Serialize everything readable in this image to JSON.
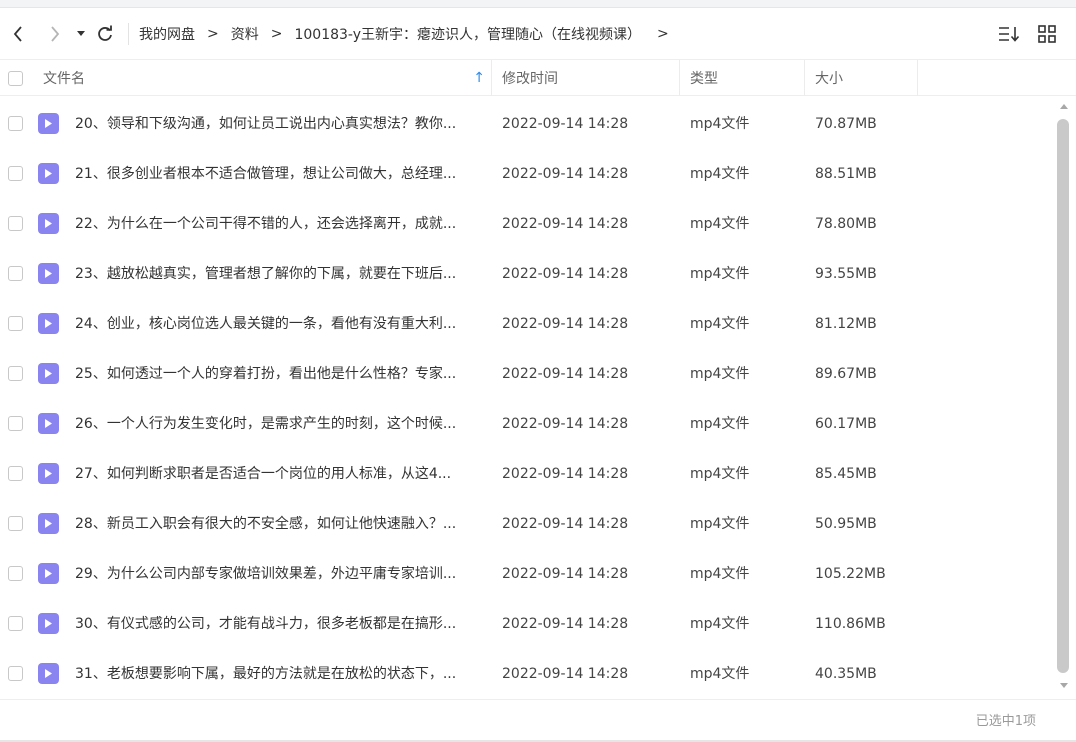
{
  "toolbar": {
    "back_icon": "chevron-left-icon",
    "forward_icon": "chevron-right-icon",
    "dropdown_icon": "caret-down-icon",
    "refresh_icon": "refresh-icon",
    "breadcrumb": [
      "我的网盘",
      "资料",
      "100183-y王新宇：瘪迹识人，管理随心（在线视频课）"
    ],
    "separator": ">",
    "sort_icon": "sort-list-icon",
    "grid_icon": "grid-view-icon"
  },
  "table": {
    "headers": {
      "name": "文件名",
      "modified": "修改时间",
      "type": "类型",
      "size": "大小"
    },
    "sort_indicator": "↑",
    "rows": [
      {
        "name": "20、领导和下级沟通，如何让员工说出内心真实想法？教你...",
        "modified": "2022-09-14 14:28",
        "type": "mp4文件",
        "size": "70.87MB"
      },
      {
        "name": "21、很多创业者根本不适合做管理，想让公司做大，总经理...",
        "modified": "2022-09-14 14:28",
        "type": "mp4文件",
        "size": "88.51MB"
      },
      {
        "name": "22、为什么在一个公司干得不错的人，还会选择离开，成就...",
        "modified": "2022-09-14 14:28",
        "type": "mp4文件",
        "size": "78.80MB"
      },
      {
        "name": "23、越放松越真实，管理者想了解你的下属，就要在下班后...",
        "modified": "2022-09-14 14:28",
        "type": "mp4文件",
        "size": "93.55MB"
      },
      {
        "name": "24、创业，核心岗位选人最关键的一条，看他有没有重大利...",
        "modified": "2022-09-14 14:28",
        "type": "mp4文件",
        "size": "81.12MB"
      },
      {
        "name": "25、如何透过一个人的穿着打扮，看出他是什么性格？专家...",
        "modified": "2022-09-14 14:28",
        "type": "mp4文件",
        "size": "89.67MB"
      },
      {
        "name": "26、一个人行为发生变化时，是需求产生的时刻，这个时候...",
        "modified": "2022-09-14 14:28",
        "type": "mp4文件",
        "size": "60.17MB"
      },
      {
        "name": "27、如何判断求职者是否适合一个岗位的用人标准，从这4...",
        "modified": "2022-09-14 14:28",
        "type": "mp4文件",
        "size": "85.45MB"
      },
      {
        "name": "28、新员工入职会有很大的不安全感，如何让他快速融入？...",
        "modified": "2022-09-14 14:28",
        "type": "mp4文件",
        "size": "50.95MB"
      },
      {
        "name": "29、为什么公司内部专家做培训效果差，外边平庸专家培训...",
        "modified": "2022-09-14 14:28",
        "type": "mp4文件",
        "size": "105.22MB"
      },
      {
        "name": "30、有仪式感的公司，才能有战斗力，很多老板都是在搞形...",
        "modified": "2022-09-14 14:28",
        "type": "mp4文件",
        "size": "110.86MB"
      },
      {
        "name": "31、老板想要影响下属，最好的方法就是在放松的状态下，...",
        "modified": "2022-09-14 14:28",
        "type": "mp4文件",
        "size": "40.35MB"
      }
    ]
  },
  "status": {
    "selected": "已选中1项"
  },
  "colors": {
    "file_icon": "#8a84f0",
    "sort_arrow": "#2b8cf0",
    "scroll_thumb": "#c9c9c9"
  }
}
